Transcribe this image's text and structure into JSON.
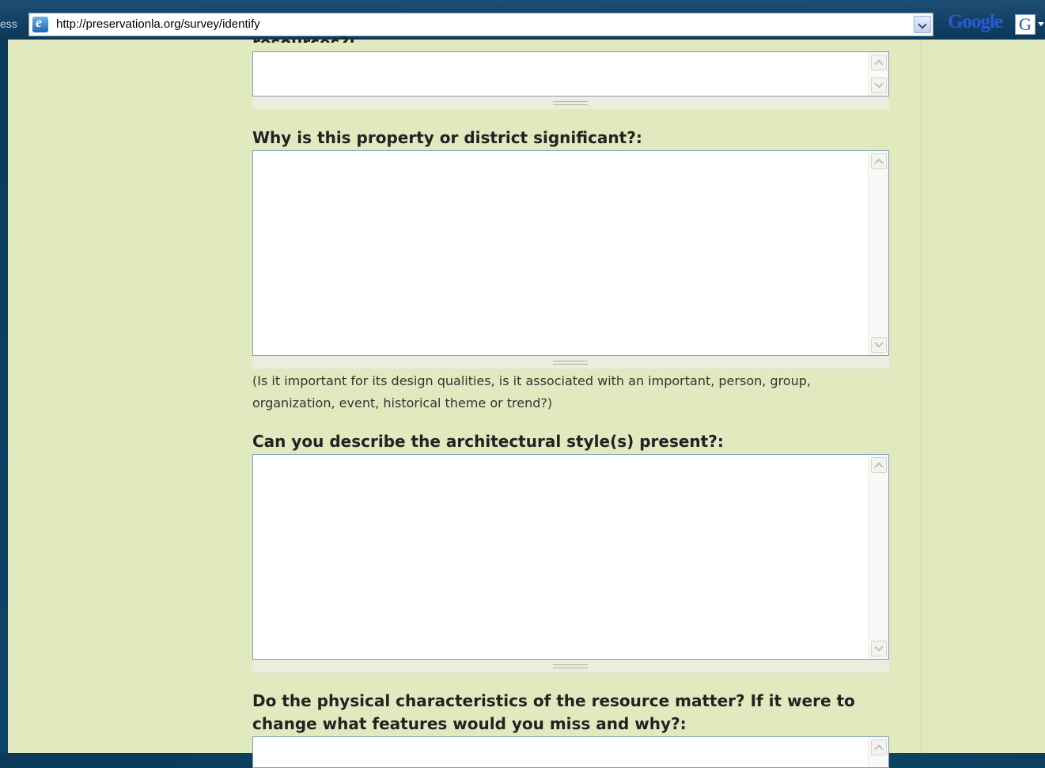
{
  "browser": {
    "address_label": "ess",
    "url": "http://preservationla.org/survey/identify",
    "search_brand": "Google",
    "search_button": "G"
  },
  "form": {
    "cut_label": "resources?:",
    "q1": {
      "label": "Why is this property or district significant?:",
      "value": "",
      "help": "(Is it important for its design qualities, is it associated with an important, person, group, organization, event, historical theme or trend?)"
    },
    "q2": {
      "label": "Can you describe the architectural style(s) present?:",
      "value": ""
    },
    "q3": {
      "label": "Do the physical characteristics of the resource matter? If it were to change what features would you miss and why?:",
      "value": ""
    }
  },
  "colors": {
    "page_background": "#e1e9bf",
    "frame_background": "#0e4466"
  }
}
